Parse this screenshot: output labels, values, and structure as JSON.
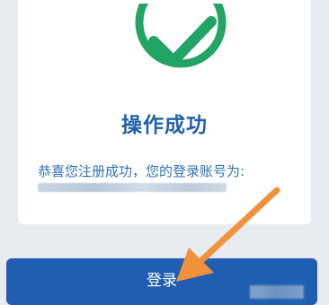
{
  "result": {
    "title": "操作成功",
    "message": "恭喜您注册成功，您的登录账号为:",
    "account_label": "[blurred account id]"
  },
  "actions": {
    "login_label": "登录"
  },
  "colors": {
    "success_green": "#21a464",
    "title_blue": "#1f63a6",
    "button_blue": "#1f5eb0",
    "annotation_orange": "#f0923c"
  },
  "icons": {
    "success": "check-circle-icon",
    "annotation": "arrow-icon"
  }
}
